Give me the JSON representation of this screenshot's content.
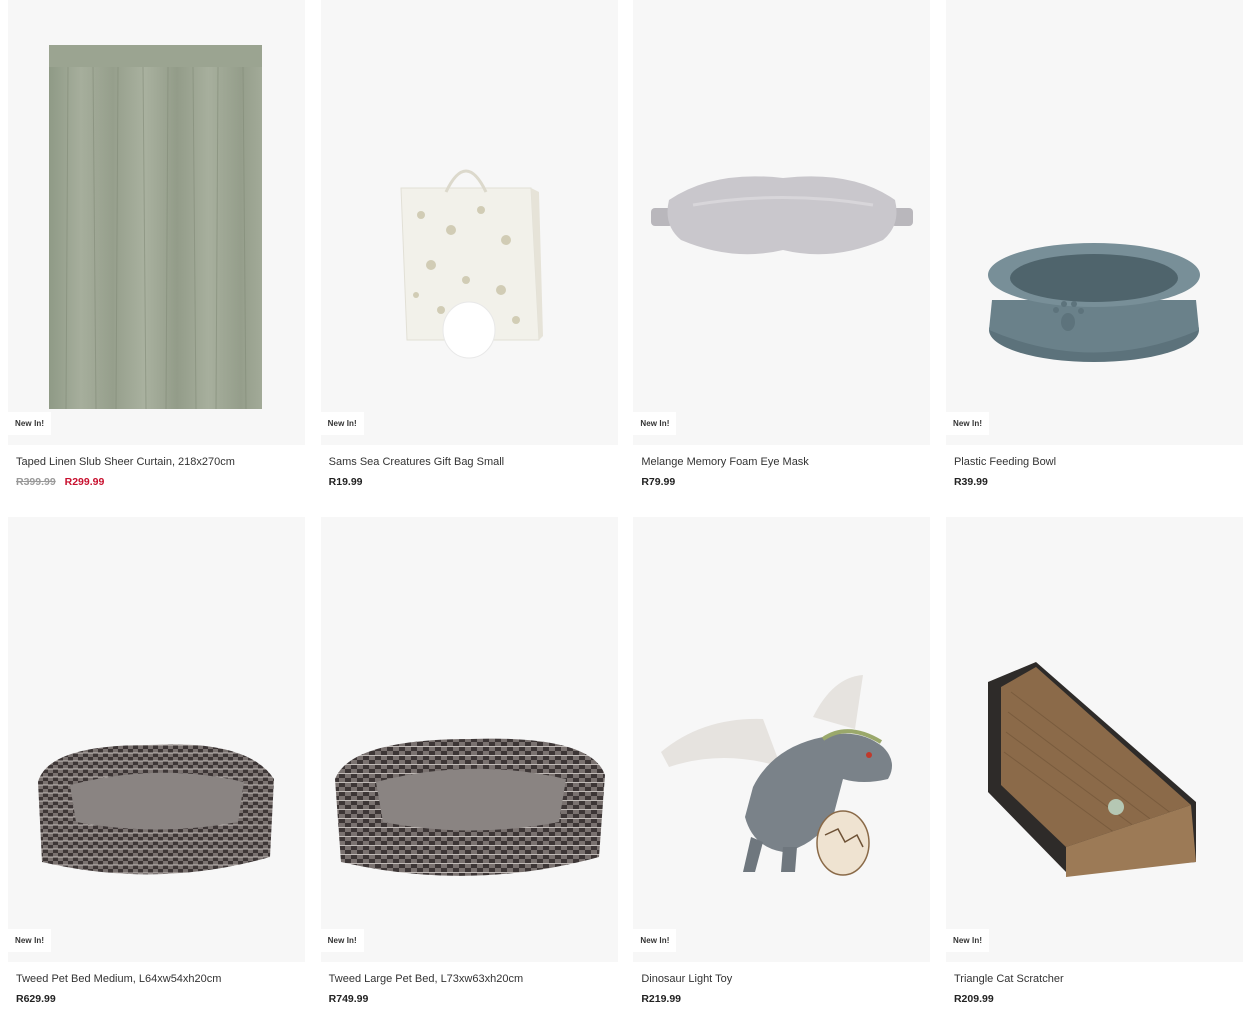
{
  "products": [
    {
      "title": "Taped Linen Slub Sheer Curtain, 218x270cm",
      "badge": "New In!",
      "old_price": "R399.99",
      "price": "R299.99",
      "icon": "curtain-image"
    },
    {
      "title": "Sams Sea Creatures Gift Bag Small",
      "badge": "New In!",
      "price": "R19.99",
      "icon": "gift-bag-image"
    },
    {
      "title": "Melange Memory Foam Eye Mask",
      "badge": "New In!",
      "price": "R79.99",
      "icon": "eye-mask-image"
    },
    {
      "title": "Plastic Feeding Bowl",
      "badge": "New In!",
      "price": "R39.99",
      "icon": "pet-bowl-image"
    },
    {
      "title": "Tweed Pet Bed Medium, L64xw54xh20cm",
      "badge": "New In!",
      "price": "R629.99",
      "icon": "pet-bed-image"
    },
    {
      "title": "Tweed Large Pet Bed, L73xw63xh20cm",
      "badge": "New In!",
      "price": "R749.99",
      "icon": "pet-bed-image"
    },
    {
      "title": "Dinosaur Light Toy",
      "badge": "New In!",
      "price": "R219.99",
      "icon": "dinosaur-toy-image"
    },
    {
      "title": "Triangle Cat Scratcher",
      "badge": "New In!",
      "price": "R209.99",
      "icon": "cat-scratcher-image"
    }
  ],
  "colors": {
    "sale_price": "#c8102e",
    "old_price": "#999999",
    "card_bg": "#f7f7f7"
  }
}
